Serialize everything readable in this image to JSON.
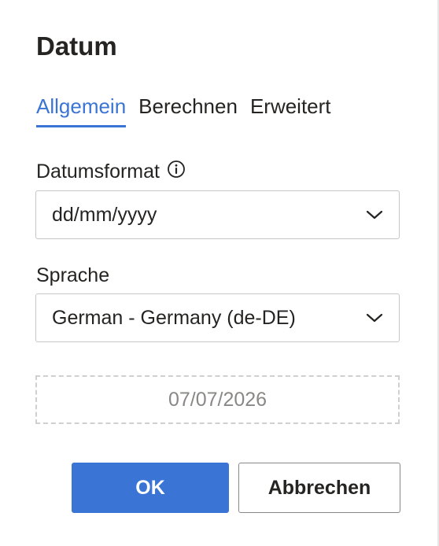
{
  "dialog": {
    "title": "Datum"
  },
  "tabs": [
    {
      "label": "Allgemein",
      "active": true
    },
    {
      "label": "Berechnen",
      "active": false
    },
    {
      "label": "Erweitert",
      "active": false
    }
  ],
  "date_format": {
    "label": "Datumsformat",
    "info_icon": "info-icon",
    "value": "dd/mm/yyyy"
  },
  "language": {
    "label": "Sprache",
    "value": "German - Germany (de-DE)"
  },
  "preview": {
    "value": "07/07/2026"
  },
  "buttons": {
    "ok": "OK",
    "cancel": "Abbrechen"
  },
  "colors": {
    "accent": "#3a74d4",
    "text": "#252423",
    "muted": "#8a8886",
    "border": "#c8c6c4"
  }
}
